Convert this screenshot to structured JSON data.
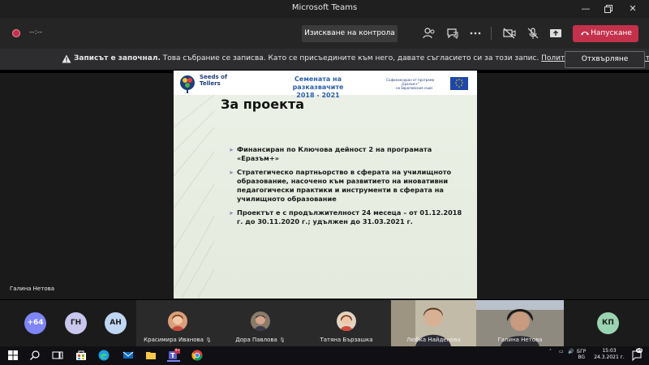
{
  "window": {
    "title": "Microsoft Teams"
  },
  "toolbar": {
    "timer": "--:--",
    "stop_control_label": "Изискване на контрола",
    "leave_label": "Напускане"
  },
  "notice": {
    "bold": "Записът е започнал.",
    "text": " Това събрание се записва. Като се присъедините към него, давате съгласието си за този запис. ",
    "link": "Политика за поверителност",
    "dismiss_label": "Отхвърляне"
  },
  "stage": {
    "presenter_name": "Галина Нетова"
  },
  "slide": {
    "logo_line1": "Seeds of",
    "logo_line2": "Tellers",
    "header_line1": "Семената на разказвачите",
    "header_line2": "2018 - 2021",
    "eu_line1": "Съфинансиран от програма",
    "eu_line2": "„Еразъм+“",
    "eu_line3": "на Европейския съюз",
    "title": "За проекта",
    "bullets": [
      "Финансиран по Ключова дейност 2 на програмата «Еразъм+»",
      "Стратегическо партньорство  в сферата на училищното образование,  насочено към развитието на иновативни педагогически практики и инструменти в сферата на училищното образование",
      "Проектът е с продължителност 24 месеца – от 01.12.2018 г. до 30.11.2020 г.; удължен до 31.03.2021 г."
    ]
  },
  "participants": {
    "overflow": "+64",
    "circles": [
      {
        "initials": "ГН",
        "color": "#c9c7ee"
      },
      {
        "initials": "АН",
        "color": "#c0d6f2"
      }
    ],
    "tiles": [
      {
        "name": "Красимира Иванова"
      },
      {
        "name": "Дора Павлова"
      },
      {
        "name": "Татяна Бързашка"
      },
      {
        "name": "Любка Найденова"
      },
      {
        "name": "Галина Нетова"
      }
    ],
    "right_initials": "КП"
  },
  "taskbar": {
    "lang_top": "БГР",
    "lang_bottom": "BG",
    "time": "15:03",
    "date": "24.3.2021 г.",
    "teams_badge": "9+",
    "notif_count": "16"
  }
}
